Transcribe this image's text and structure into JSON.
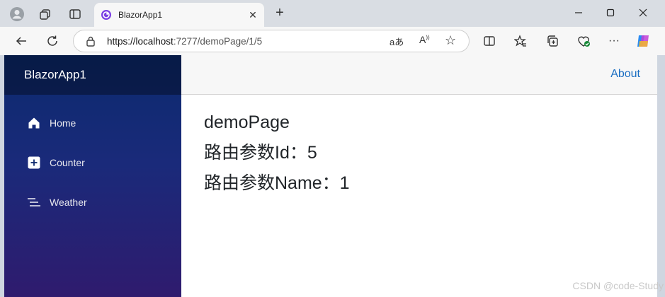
{
  "browser": {
    "tab_title": "BlazorApp1",
    "url_host": "https://localhost",
    "url_path": ":7277/demoPage/1/5",
    "icons": [
      "profile-icon",
      "workspaces-icon",
      "tab-actions-icon",
      "tab-favicon",
      "close-tab-icon",
      "new-tab-icon",
      "minimize-icon",
      "maximize-icon",
      "close-window-icon",
      "back-icon",
      "refresh-icon",
      "lock-icon",
      "read-aloud-icon",
      "translate-icon",
      "favorite-star-icon",
      "split-screen-icon",
      "favorites-icon",
      "collections-icon",
      "browser-essentials-icon",
      "more-icon",
      "copilot-icon"
    ]
  },
  "sidebar": {
    "brand": "BlazorApp1",
    "items": [
      {
        "label": "Home",
        "icon": "home-icon"
      },
      {
        "label": "Counter",
        "icon": "plus-square-icon"
      },
      {
        "label": "Weather",
        "icon": "list-icon"
      }
    ]
  },
  "topbar": {
    "about": "About"
  },
  "main": {
    "heading": "demoPage",
    "line_id": "路由参数Id：5",
    "line_name": "路由参数Name：1"
  },
  "watermark": "CSDN @code-Study",
  "colors": {
    "sidebar_top": "#0b2a6e",
    "sidebar_bottom": "#2f1b6e",
    "link": "#1b6ec2"
  }
}
